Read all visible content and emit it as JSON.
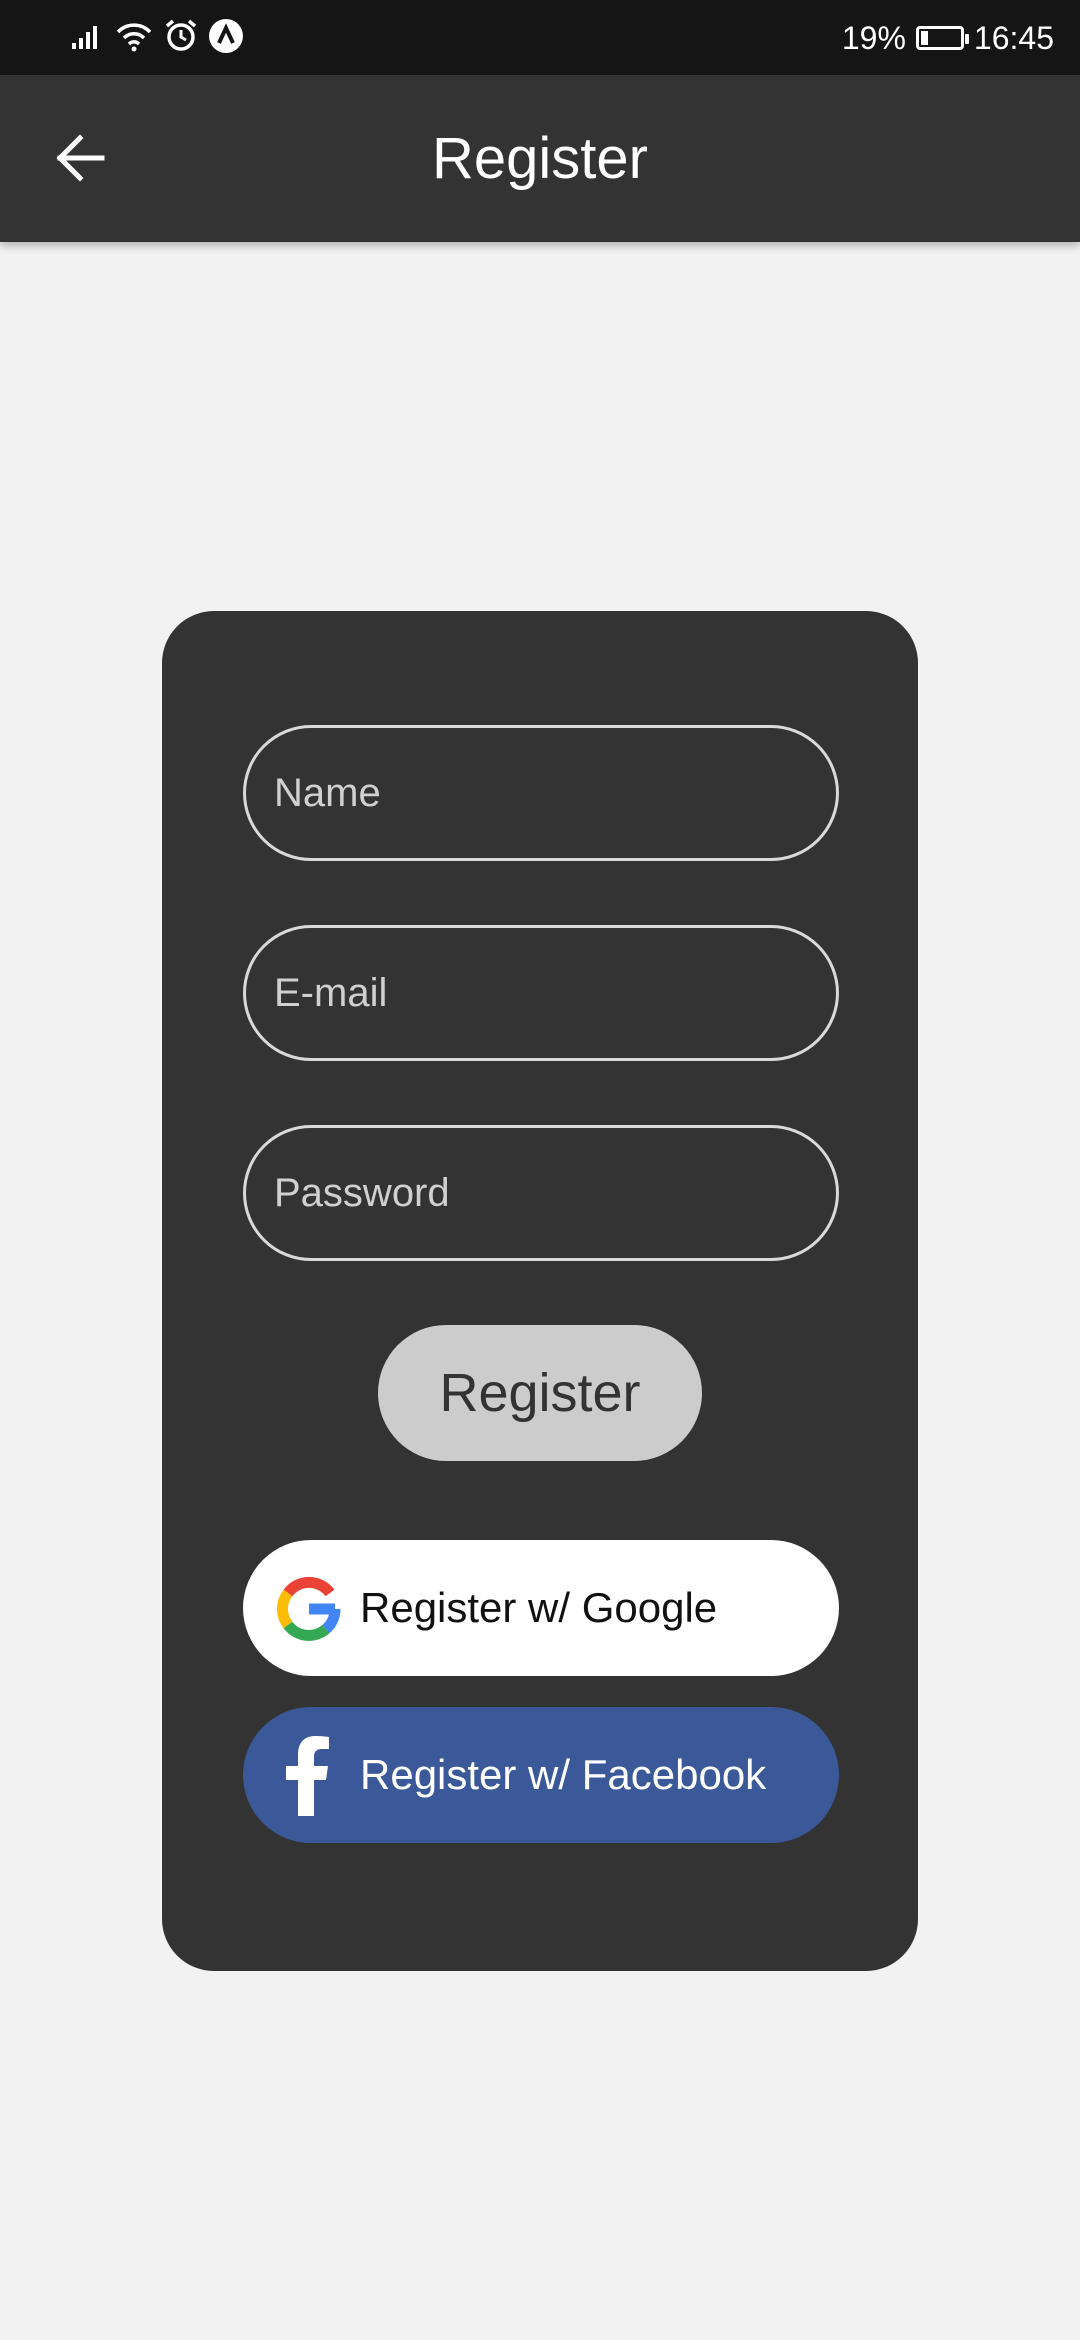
{
  "status_bar": {
    "battery_percent_text": "19%",
    "battery_level": 0.19,
    "time": "16:45"
  },
  "app_bar": {
    "title": "Register",
    "back_icon": "arrow-left-icon"
  },
  "form": {
    "name_placeholder": "Name",
    "email_placeholder": "E-mail",
    "password_placeholder": "Password",
    "register_label": "Register"
  },
  "social": {
    "google_label": "Register w/ Google",
    "facebook_label": "Register w/ Facebook",
    "google_icon": "google-g-icon",
    "facebook_icon": "facebook-f-icon"
  },
  "colors": {
    "app_bar": "#333333",
    "card": "#333333",
    "background": "#f2f2f2",
    "register_button": "#cccccc",
    "facebook": "#3b5998",
    "google_button": "#ffffff"
  }
}
